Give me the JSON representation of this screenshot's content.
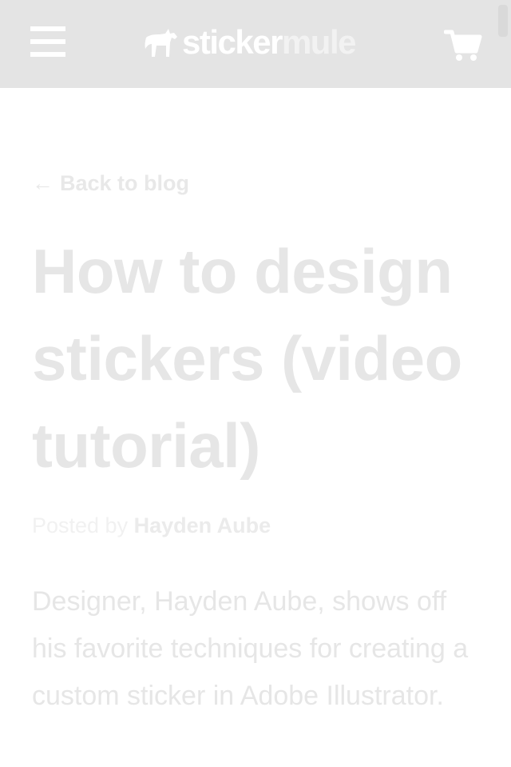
{
  "header": {
    "logo_part1": "sticker",
    "logo_part2": "mule",
    "colors": {
      "background": "#e4e4e4",
      "icon": "#ffffff"
    },
    "icons": {
      "menu": "hamburger-menu-icon",
      "cart": "cart-icon",
      "logo": "mule-logo-icon"
    }
  },
  "nav": {
    "back_arrow": "←",
    "back_label": "Back to blog"
  },
  "article": {
    "title": "How to design stickers (video tutorial)",
    "posted_by_label": "Posted by",
    "author": "Hayden Aube",
    "intro": "Designer, Hayden Aube, shows off his favorite techniques for creating a custom sticker in Adobe Illustrator."
  }
}
